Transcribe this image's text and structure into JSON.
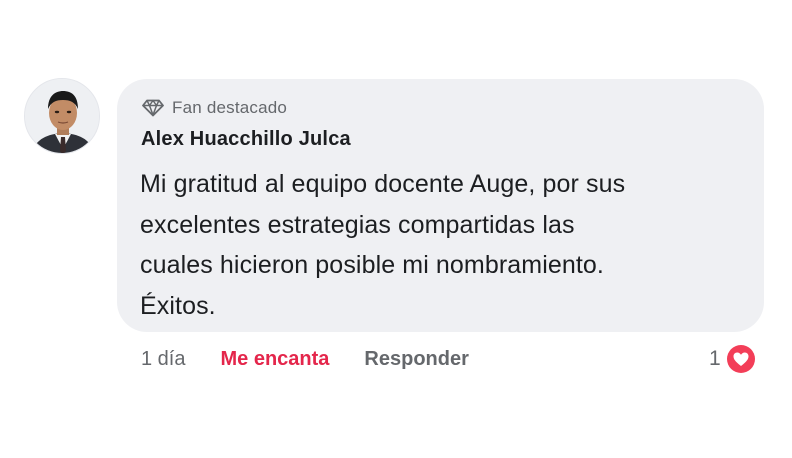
{
  "comment": {
    "badge": {
      "icon": "diamond-icon",
      "label": "Fan destacado"
    },
    "author": "Alex Huacchillo Julca",
    "text_lines": [
      "Mi gratitud al equipo docente Auge, por sus",
      "excelentes estrategias compartidas las",
      "cuales hicieron posible mi nombramiento.",
      "Éxitos."
    ],
    "bubble_color": "#eff0f3"
  },
  "actions": {
    "time": "1 día",
    "like_label": "Me encanta",
    "like_color": "#e4264b",
    "reply_label": "Responder"
  },
  "reactions": {
    "count": "1",
    "icon": "love-reaction-icon",
    "color": "#f33e58"
  }
}
